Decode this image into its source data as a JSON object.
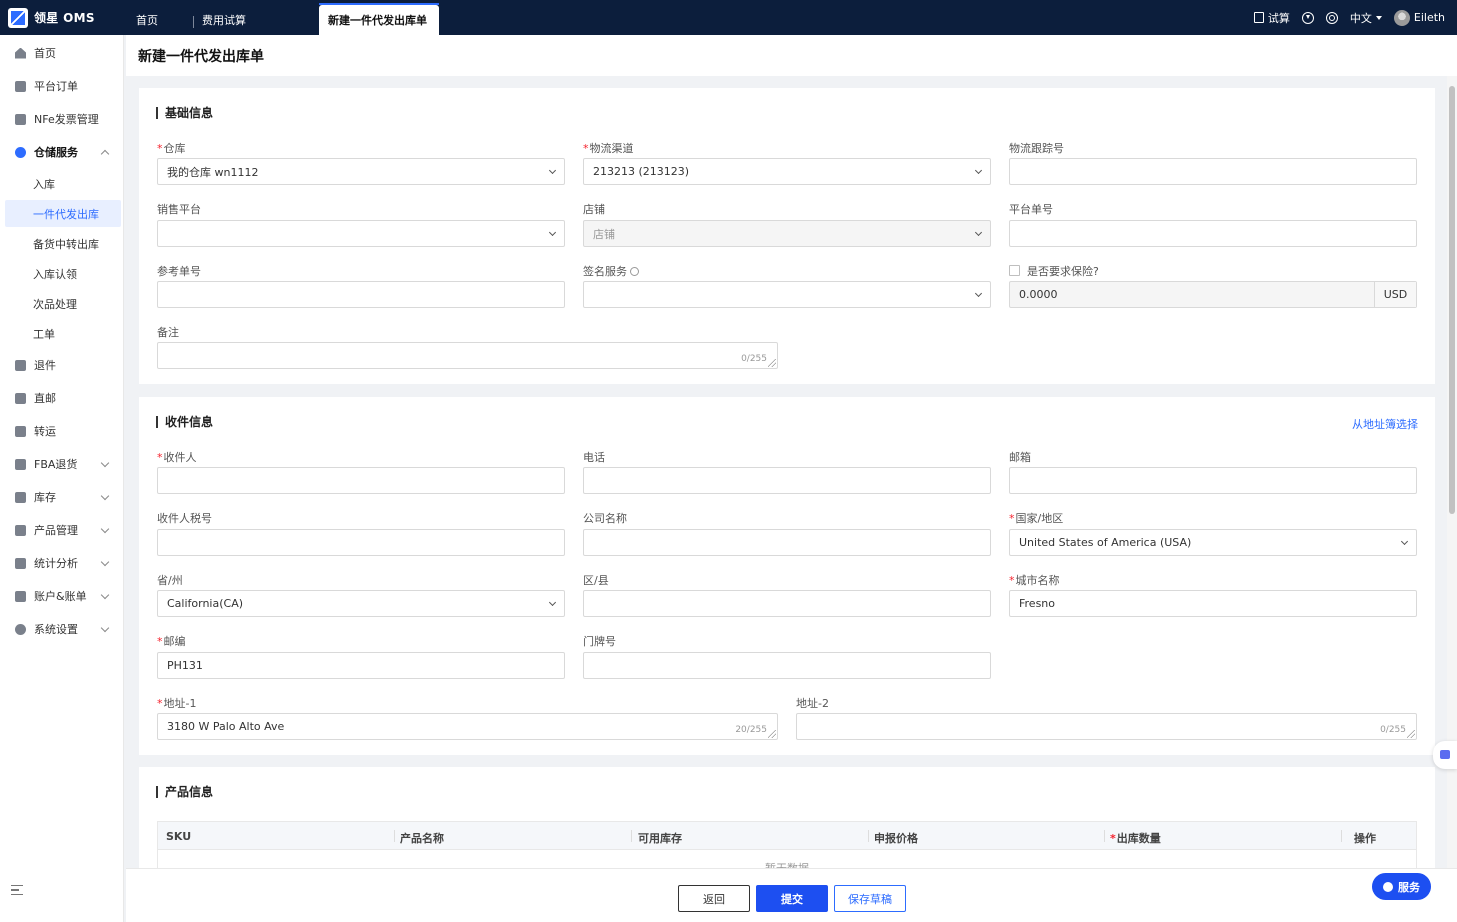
{
  "app": {
    "title": "领星 OMS"
  },
  "tabs": [
    {
      "label": "首页"
    },
    {
      "label": "费用试算"
    },
    {
      "label": "新建一件代发出库单"
    }
  ],
  "topbar": {
    "calc_label": "试算",
    "language": "中文",
    "user": "Eileth"
  },
  "sidebar": {
    "items": [
      {
        "label": "首页"
      },
      {
        "label": "平台订单"
      },
      {
        "label": "NFe发票管理"
      },
      {
        "label": "仓储服务"
      },
      {
        "label": "退件"
      },
      {
        "label": "直邮"
      },
      {
        "label": "转运"
      },
      {
        "label": "FBA退货"
      },
      {
        "label": "库存"
      },
      {
        "label": "产品管理"
      },
      {
        "label": "统计分析"
      },
      {
        "label": "账户&账单"
      },
      {
        "label": "系统设置"
      }
    ],
    "sub_items": [
      {
        "label": "入库"
      },
      {
        "label": "一件代发出库"
      },
      {
        "label": "备货中转出库"
      },
      {
        "label": "入库认领"
      },
      {
        "label": "次品处理"
      },
      {
        "label": "工单"
      }
    ]
  },
  "page": {
    "title": "新建一件代发出库单"
  },
  "basic": {
    "title": "基础信息",
    "warehouse": {
      "label": "仓库",
      "value": "我的仓库 wn1112"
    },
    "channel": {
      "label": "物流渠道",
      "value": "213213 (213123)"
    },
    "tracking": {
      "label": "物流跟踪号",
      "value": ""
    },
    "platform": {
      "label": "销售平台",
      "value": ""
    },
    "store": {
      "label": "店铺",
      "placeholder": "店铺"
    },
    "platform_no": {
      "label": "平台单号",
      "value": ""
    },
    "ref_no": {
      "label": "参考单号",
      "value": ""
    },
    "signature": {
      "label": "签名服务",
      "value": ""
    },
    "insurance": {
      "label": "是否要求保险?",
      "value": "0.0000",
      "currency": "USD"
    },
    "remark": {
      "label": "备注",
      "counter": "0/255"
    }
  },
  "recipient": {
    "title": "收件信息",
    "address_book_link": "从地址簿选择",
    "name": {
      "label": "收件人",
      "value": ""
    },
    "phone": {
      "label": "电话",
      "value": ""
    },
    "email": {
      "label": "邮箱",
      "value": ""
    },
    "tax_no": {
      "label": "收件人税号",
      "value": ""
    },
    "company": {
      "label": "公司名称",
      "value": ""
    },
    "country": {
      "label": "国家/地区",
      "value": "United States of America (USA)"
    },
    "state": {
      "label": "省/州",
      "value": "California(CA)"
    },
    "district": {
      "label": "区/县",
      "value": ""
    },
    "city": {
      "label": "城市名称",
      "value": "Fresno"
    },
    "zip": {
      "label": "邮编",
      "value": "PH131"
    },
    "house_no": {
      "label": "门牌号",
      "value": ""
    },
    "address1": {
      "label": "地址-1",
      "value": "3180 W Palo Alto Ave",
      "counter": "20/255"
    },
    "address2": {
      "label": "地址-2",
      "value": "",
      "counter": "0/255"
    }
  },
  "product": {
    "title": "产品信息",
    "columns": [
      "SKU",
      "产品名称",
      "可用库存",
      "申报价格",
      "出库数量",
      "操作"
    ],
    "empty_text": "暂无数据"
  },
  "actions": {
    "back": "返回",
    "submit": "提交",
    "draft": "保存草稿",
    "service": "服务"
  },
  "colors": {
    "primary": "#1d4ff1",
    "topbar": "#0c1e3c",
    "required": "#f5222d"
  }
}
